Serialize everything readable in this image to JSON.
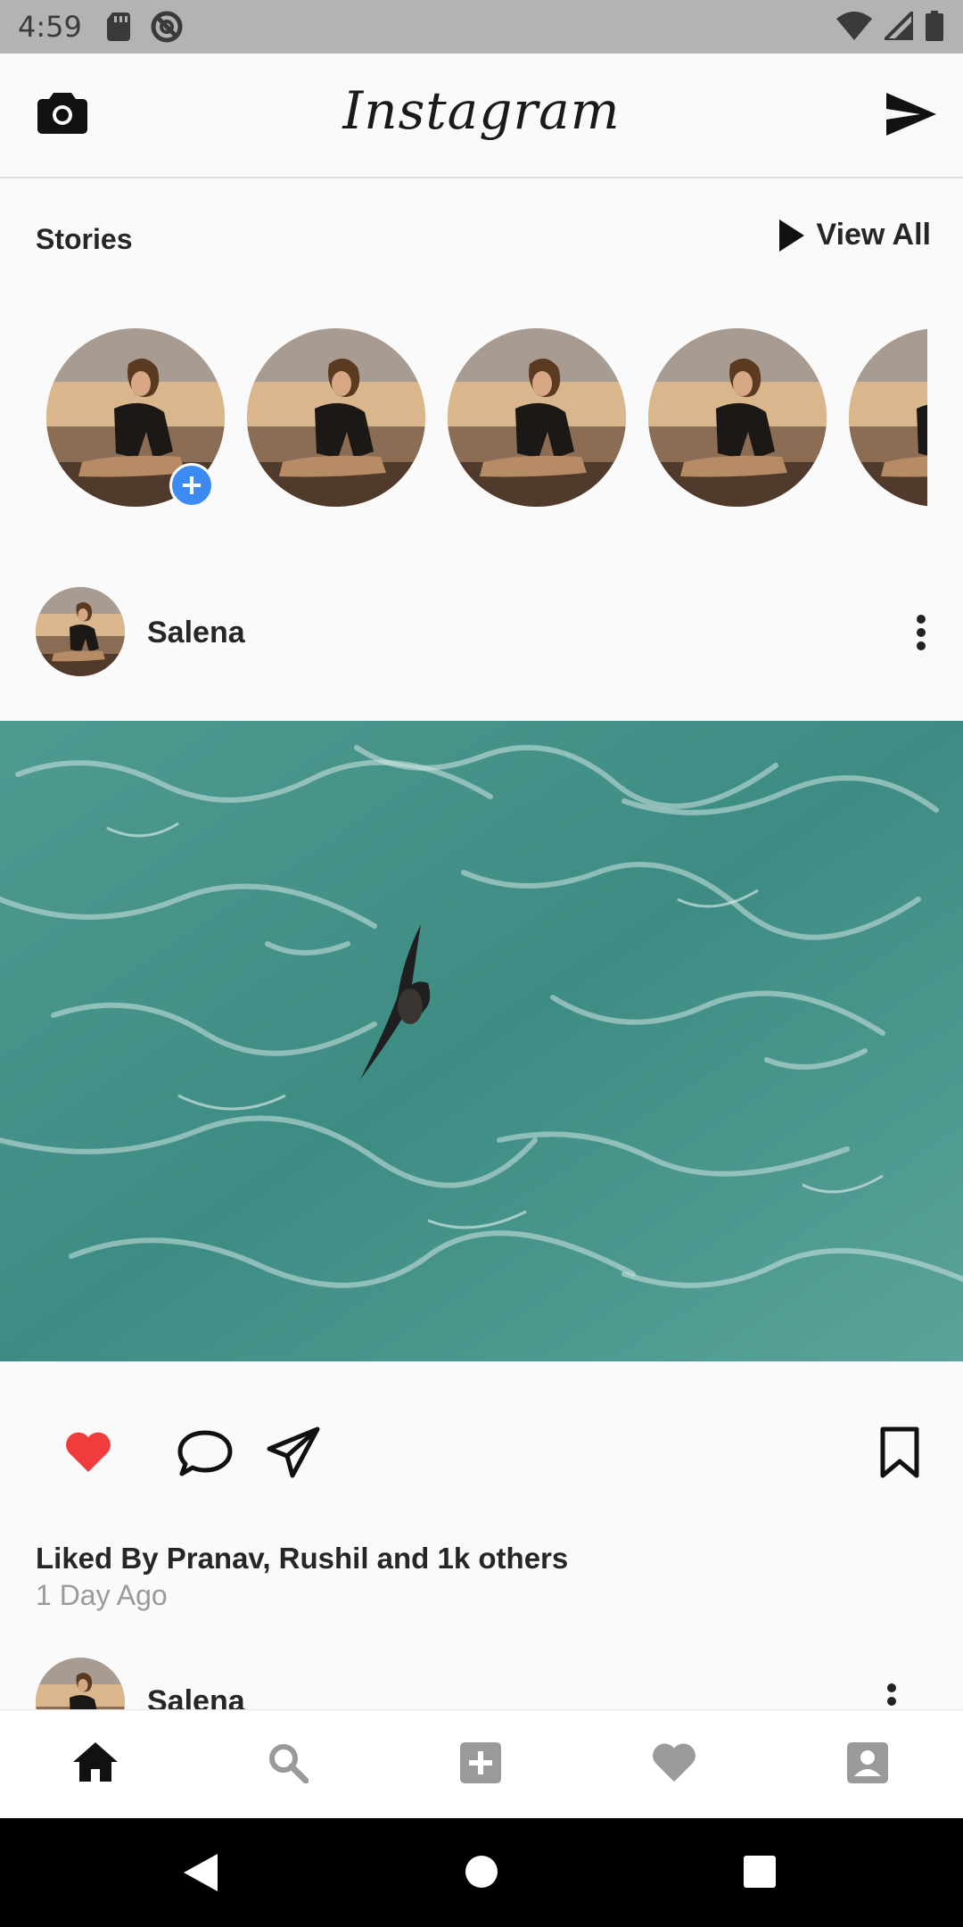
{
  "status_bar": {
    "time": "4:59",
    "icons": [
      "sd-card-icon",
      "do-not-disturb-icon",
      "wifi-icon",
      "signal-icon",
      "battery-icon"
    ]
  },
  "app_bar": {
    "title": "Instagram",
    "left_icon": "camera-icon",
    "right_icon": "direct-send-icon"
  },
  "stories": {
    "title": "Stories",
    "view_all_label": "View All",
    "count_visible": 5,
    "add_badge": "+"
  },
  "post": {
    "username": "Salena",
    "liked_by": "Liked By Pranav, Rushil and 1k others",
    "time_ago": "1 Day Ago",
    "liked": true,
    "like_color": "#f03c3c"
  },
  "next_post": {
    "username": "Salena"
  },
  "bottom_nav": {
    "items": [
      "home-icon",
      "search-icon",
      "add-post-icon",
      "activity-heart-icon",
      "profile-icon"
    ],
    "active": "home-icon"
  },
  "colors": {
    "accent_blue": "#3d8bf2",
    "ocean": "#3f8f86"
  }
}
